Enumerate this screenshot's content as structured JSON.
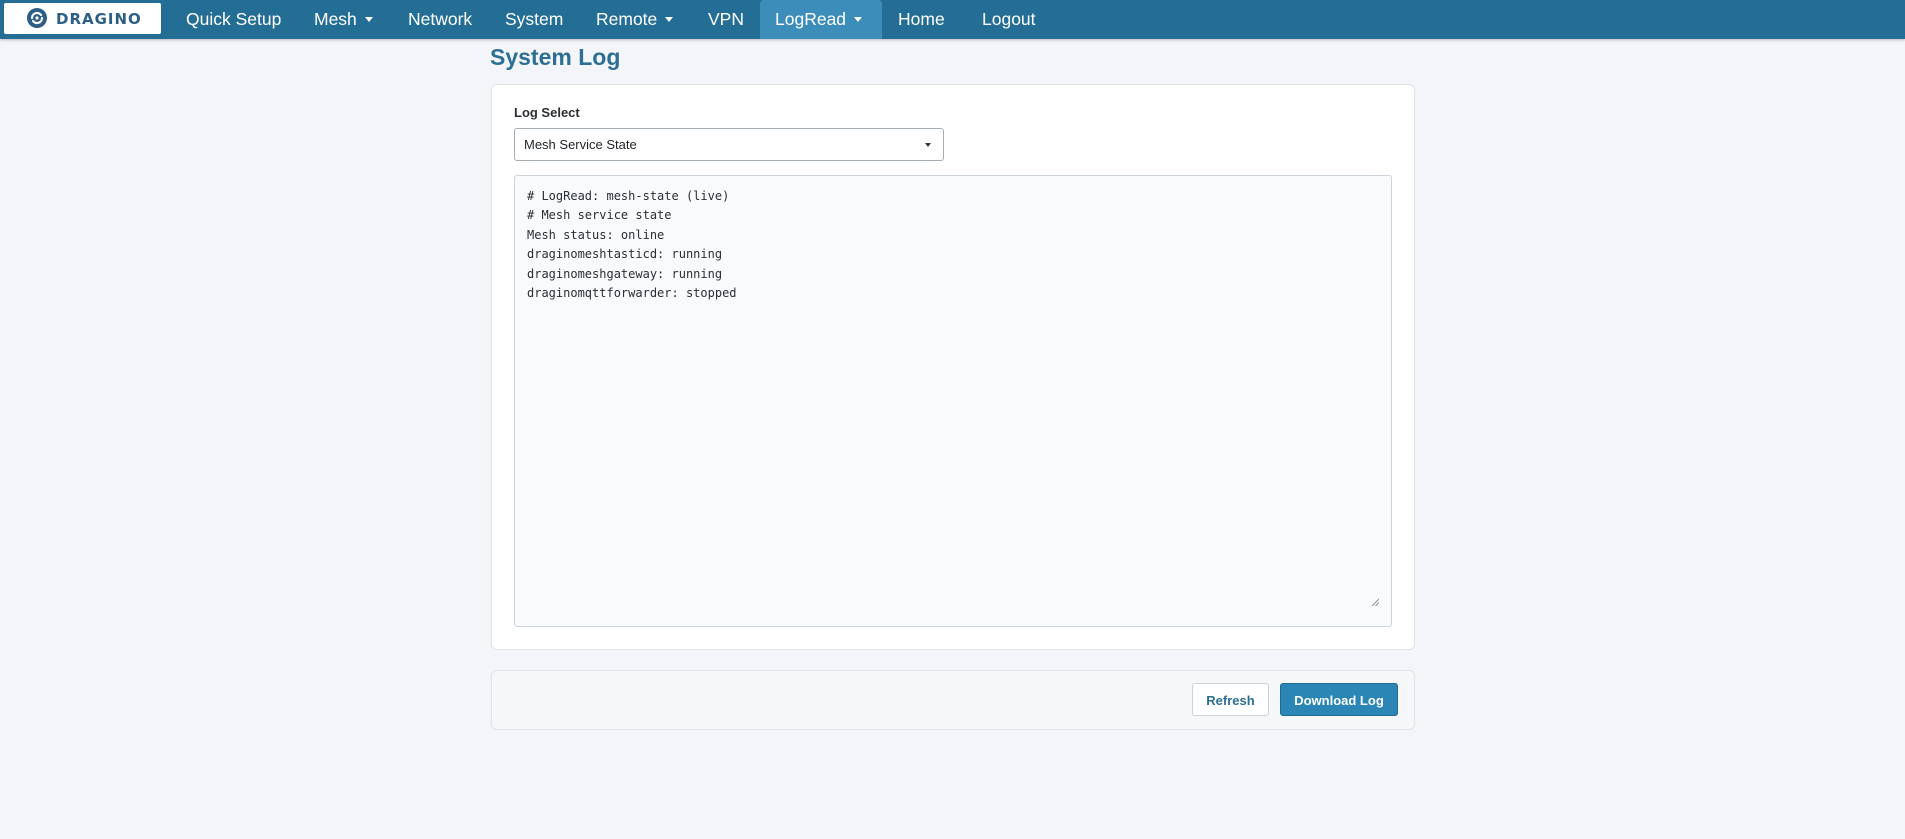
{
  "brand": {
    "logo_text": "DRAGINO",
    "nav_bg_color": "#246e96",
    "nav_active_color": "#3d8dbb",
    "accent_color": "#2b86b5"
  },
  "nav": {
    "quick_setup": "Quick Setup",
    "mesh": "Mesh",
    "network": "Network",
    "system": "System",
    "remote": "Remote",
    "vpn": "VPN",
    "logread": "LogRead",
    "home": "Home",
    "logout": "Logout"
  },
  "page": {
    "title": "System Log"
  },
  "log_select": {
    "label": "Log Select",
    "selected": "Mesh Service State"
  },
  "log": {
    "lines": [
      "# LogRead: mesh-state (live)",
      "# Mesh service state",
      "Mesh status: online",
      "draginomeshtasticd: running",
      "draginomeshgateway: running",
      "draginomqttforwarder: stopped"
    ]
  },
  "actions": {
    "refresh": "Refresh",
    "download": "Download Log"
  }
}
